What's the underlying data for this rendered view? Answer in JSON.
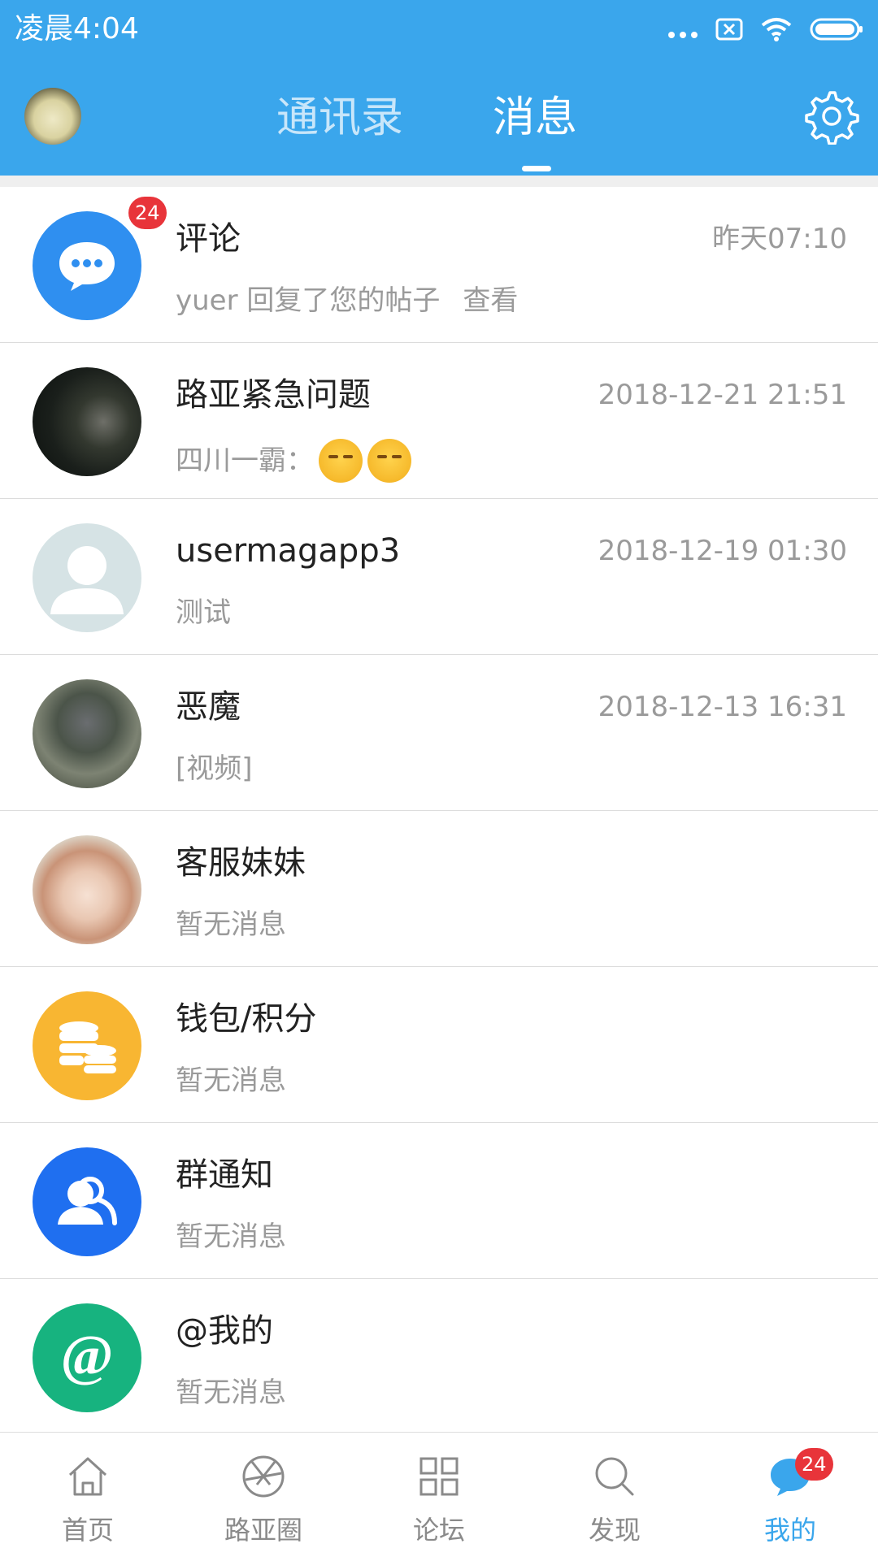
{
  "status_bar": {
    "time": "凌晨4:04",
    "icons": [
      "more-dots-icon",
      "sim-x-icon",
      "wifi-icon",
      "battery-icon"
    ]
  },
  "header": {
    "tabs": [
      {
        "label": "通讯录",
        "active": false
      },
      {
        "label": "消息",
        "active": true
      }
    ],
    "icons": [
      "avatar",
      "gear-icon"
    ]
  },
  "messages": [
    {
      "title": "评论",
      "subtitle": "yuer 回复了您的帖子",
      "link": "查看",
      "time": "昨天07:10",
      "badge": "24",
      "icon": "chat-bubble-icon",
      "color": "#2f8ff0"
    },
    {
      "title": "路亚紧急问题",
      "subtitle": "四川一霸：",
      "time": "2018-12-21 21:51",
      "emoji_count": 2
    },
    {
      "title": "usermagapp3",
      "subtitle": "测试",
      "time": "2018-12-19 01:30"
    },
    {
      "title": "恶魔",
      "subtitle": "[视频]",
      "time": "2018-12-13 16:31"
    },
    {
      "title": "客服妹妹",
      "subtitle": "暂无消息"
    },
    {
      "title": "钱包/积分",
      "subtitle": "暂无消息",
      "icon": "coins-icon",
      "color": "#f8b632"
    },
    {
      "title": "群通知",
      "subtitle": "暂无消息",
      "icon": "group-icon",
      "color": "#1f6ff0"
    },
    {
      "title": "@我的",
      "subtitle": "暂无消息",
      "icon": "at-icon",
      "color": "#17b37f"
    }
  ],
  "bottom_nav": [
    {
      "label": "首页",
      "icon": "home-icon",
      "active": false
    },
    {
      "label": "路亚圈",
      "icon": "aperture-icon",
      "active": false
    },
    {
      "label": "论坛",
      "icon": "grid-icon",
      "active": false
    },
    {
      "label": "发现",
      "icon": "search-icon",
      "active": false
    },
    {
      "label": "我的",
      "icon": "chat-bubble-icon",
      "active": true,
      "badge": "24"
    }
  ],
  "colors": {
    "accent": "#3aa6ec",
    "badge": "#e8343a"
  }
}
